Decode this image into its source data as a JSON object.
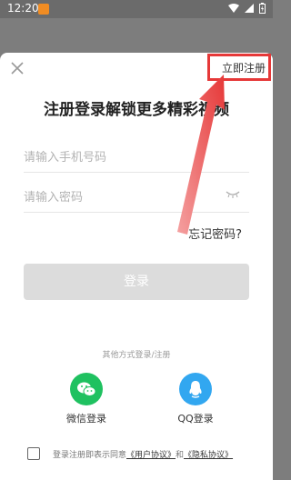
{
  "status_bar": {
    "time": "12:20"
  },
  "header": {
    "register_link": "立即注册"
  },
  "title": "注册登录解锁更多精彩视频",
  "form": {
    "phone_placeholder": "请输入手机号码",
    "password_placeholder": "请输入密码",
    "forgot_password": "忘记密码?",
    "login_button": "登录"
  },
  "other_login": {
    "divider_text": "其他方式登录/注册",
    "options": [
      {
        "label": "微信登录",
        "icon": "wechat-icon",
        "color": "#1fc160"
      },
      {
        "label": "QQ登录",
        "icon": "qq-icon",
        "color": "#32a7f0"
      }
    ]
  },
  "agreement": {
    "prefix": "登录注册即表示同意",
    "user_agreement": "《用户协议》",
    "and": "和",
    "privacy_agreement": "《隐私协议》",
    "checked": false
  },
  "colors": {
    "highlight": "#e63838",
    "button_disabled": "#dcdcdc"
  }
}
